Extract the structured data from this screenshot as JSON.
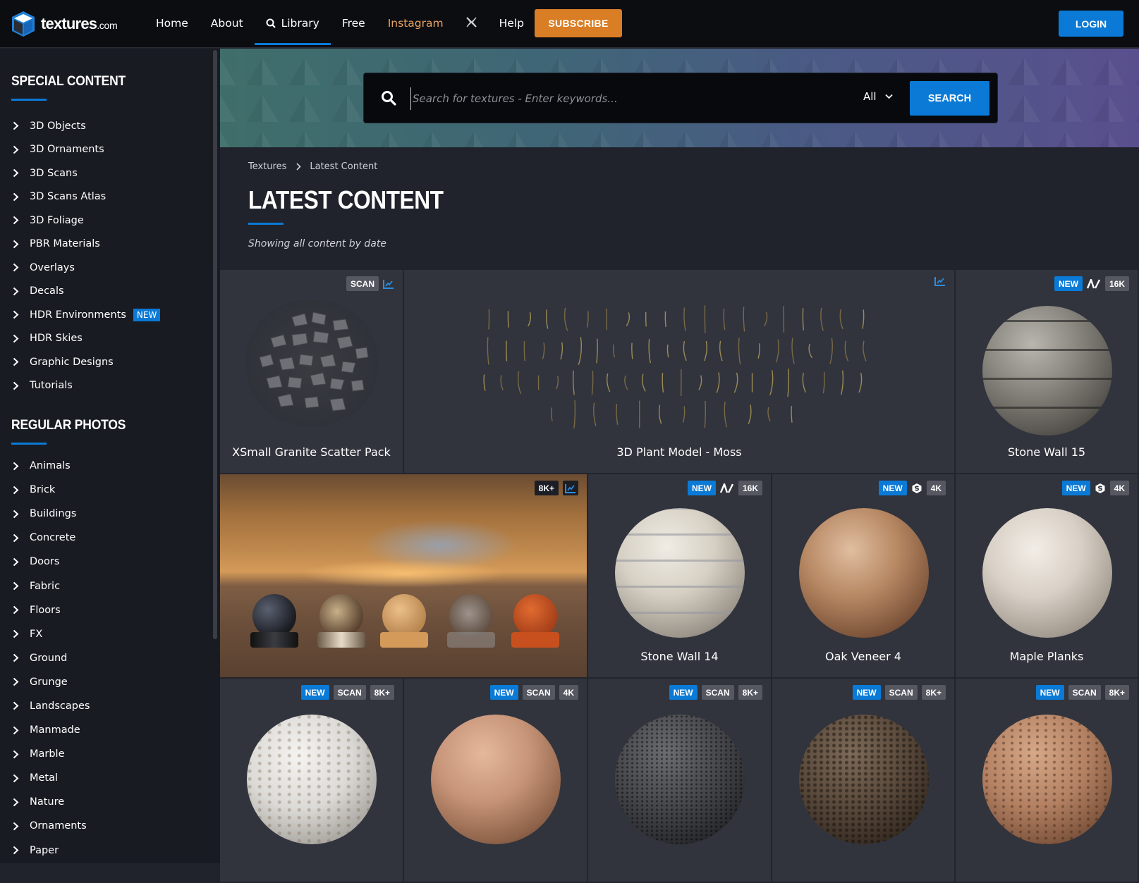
{
  "header": {
    "logo_text": "textures",
    "logo_suffix": ".com",
    "nav": [
      {
        "label": "Home",
        "active": false
      },
      {
        "label": "About",
        "active": false
      },
      {
        "label": "Library",
        "active": true,
        "icon": "search-icon"
      },
      {
        "label": "Free",
        "active": false
      },
      {
        "label": "Instagram",
        "active": false
      },
      {
        "label": "",
        "icon": "x-logo-icon"
      },
      {
        "label": "Help",
        "active": false
      }
    ],
    "subscribe_label": "SUBSCRIBE",
    "login_label": "LOGIN"
  },
  "colors": {
    "accent": "#0a7ad6",
    "subscribe": "#d97e25",
    "instagram": "#e8a363",
    "header_bg": "#0c0d11",
    "sidebar_bg": "#191b22",
    "card_bg": "#31343d"
  },
  "sidebar": {
    "special_heading": "SPECIAL CONTENT",
    "special_items": [
      {
        "label": "3D Objects"
      },
      {
        "label": "3D Ornaments"
      },
      {
        "label": "3D Scans"
      },
      {
        "label": "3D Scans Atlas"
      },
      {
        "label": "3D Foliage"
      },
      {
        "label": "PBR Materials"
      },
      {
        "label": "Overlays"
      },
      {
        "label": "Decals"
      },
      {
        "label": "HDR Environments",
        "badge": "NEW"
      },
      {
        "label": "HDR Skies"
      },
      {
        "label": "Graphic Designs"
      },
      {
        "label": "Tutorials"
      }
    ],
    "regular_heading": "REGULAR PHOTOS",
    "regular_items": [
      {
        "label": "Animals"
      },
      {
        "label": "Brick"
      },
      {
        "label": "Buildings"
      },
      {
        "label": "Concrete"
      },
      {
        "label": "Doors"
      },
      {
        "label": "Fabric"
      },
      {
        "label": "Floors"
      },
      {
        "label": "FX"
      },
      {
        "label": "Ground"
      },
      {
        "label": "Grunge"
      },
      {
        "label": "Landscapes"
      },
      {
        "label": "Manmade"
      },
      {
        "label": "Marble"
      },
      {
        "label": "Metal"
      },
      {
        "label": "Nature"
      },
      {
        "label": "Ornaments"
      },
      {
        "label": "Paper"
      }
    ]
  },
  "search": {
    "placeholder": "Search for textures - Enter keywords...",
    "value": "",
    "scope_selected": "All",
    "button_label": "SEARCH"
  },
  "main": {
    "breadcrumb": [
      "Textures",
      "Latest Content"
    ],
    "title": "LATEST CONTENT",
    "subtitle": "Showing all content by date"
  },
  "cards": [
    {
      "title": "XSmall Granite Scatter Pack",
      "badges": [
        "SCAN"
      ],
      "stats_icon": true
    },
    {
      "title": "3D Plant Model - Moss",
      "badges": [],
      "stats_icon": true
    },
    {
      "title": "Stone Wall 15",
      "badges": [
        "NEW",
        "ALPHA-ICON",
        "16K"
      ]
    },
    {
      "title": "",
      "badges": [
        "8K+"
      ],
      "stats_icon": true
    },
    {
      "title": "Stone Wall 14",
      "badges": [
        "NEW",
        "ALPHA-ICON",
        "16K"
      ]
    },
    {
      "title": "Oak Veneer 4",
      "badges": [
        "NEW",
        "SUBSTANCE-ICON",
        "4K"
      ]
    },
    {
      "title": "Maple Planks",
      "badges": [
        "NEW",
        "SUBSTANCE-ICON",
        "4K"
      ]
    },
    {
      "title": "",
      "badges": [
        "NEW",
        "SCAN",
        "8K+"
      ]
    },
    {
      "title": "",
      "badges": [
        "NEW",
        "SCAN",
        "4K"
      ]
    },
    {
      "title": "",
      "badges": [
        "NEW",
        "SCAN",
        "8K+"
      ]
    },
    {
      "title": "",
      "badges": [
        "NEW",
        "SCAN",
        "8K+"
      ]
    },
    {
      "title": "",
      "badges": [
        "NEW",
        "SCAN",
        "8K+"
      ]
    }
  ]
}
